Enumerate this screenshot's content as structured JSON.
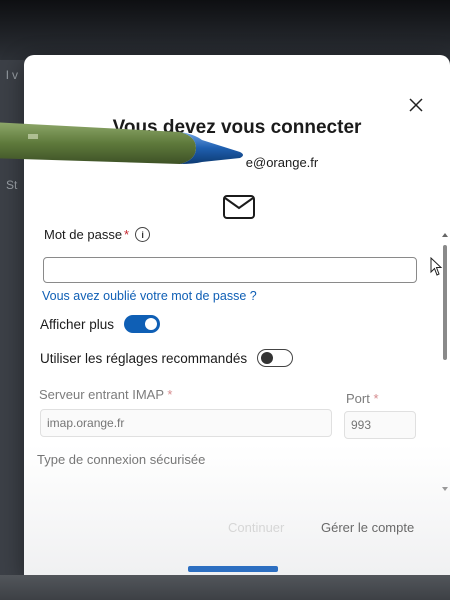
{
  "dialog": {
    "title": "Vous devez vous connecter",
    "email": "e@orange.fr",
    "close_label": "Fermer"
  },
  "password": {
    "label": "Mot de passe",
    "required_mark": "*",
    "info_icon": "info-icon",
    "value": "",
    "forgot_link": "Vous avez oublié votre mot de passe ?"
  },
  "options": {
    "show_more_label": "Afficher plus",
    "show_more_on": true,
    "recommended_label": "Utiliser les réglages recommandés",
    "recommended_on": false
  },
  "server": {
    "incoming_label": "Serveur entrant IMAP",
    "required_mark": "*",
    "incoming_placeholder": "imap.orange.fr",
    "port_label": "Port",
    "port_placeholder": "993",
    "connection_type_label": "Type de connexion sécurisée"
  },
  "footer": {
    "continue_label": "Continuer",
    "manage_label": "Gérer le compte"
  },
  "background": {
    "fragments": [
      "l v",
      "St"
    ]
  },
  "colors": {
    "accent": "#0f5fb5",
    "required": "#c4262e",
    "pen_body": "#6f8a4a",
    "pen_tip": "#1f5fb0"
  }
}
